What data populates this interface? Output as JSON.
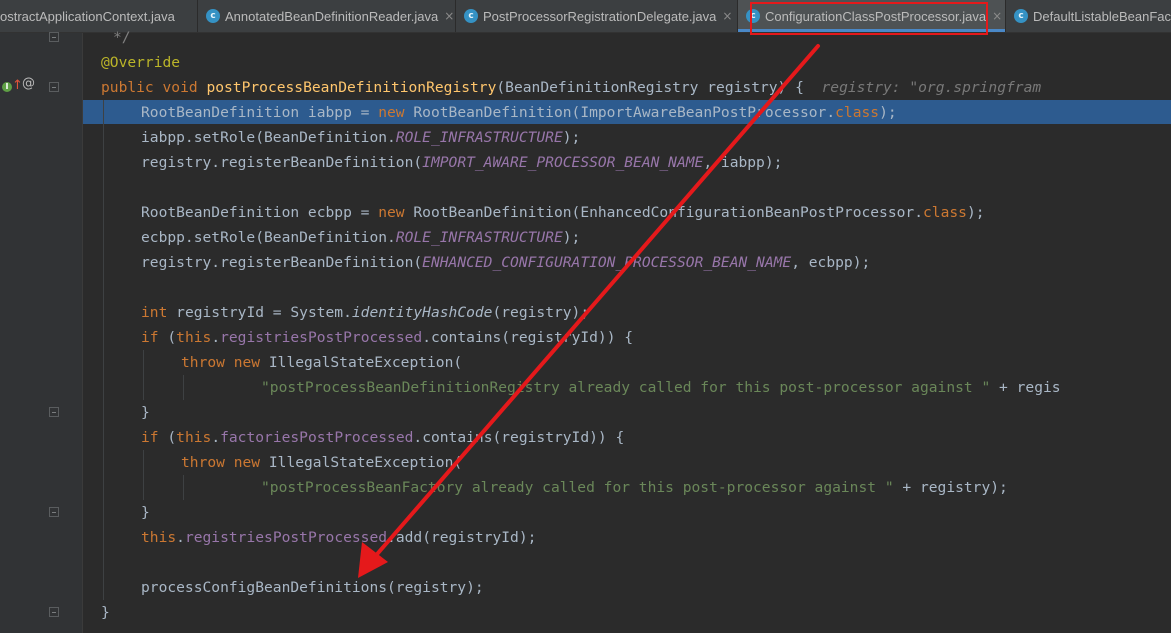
{
  "tabs": [
    {
      "label": "ostractApplicationContext.java",
      "icon": "class-icon",
      "active": false
    },
    {
      "label": "AnnotatedBeanDefinitionReader.java",
      "icon": "class-icon",
      "active": false
    },
    {
      "label": "PostProcessorRegistrationDelegate.java",
      "icon": "class-icon",
      "active": false
    },
    {
      "label": "ConfigurationClassPostProcessor.java",
      "icon": "class-icon",
      "active": true
    },
    {
      "label": "DefaultListableBeanFactc",
      "icon": "class-icon",
      "active": false
    }
  ],
  "close_glyph": "×",
  "icon_letter": "c",
  "gutter": {
    "implements_marker": "↑",
    "annotation_marker": "@"
  },
  "code": {
    "l0": "*/",
    "l1": "@Override",
    "l2": {
      "kw": "public void ",
      "fn": "postProcessBeanDefinitionRegistry",
      "rest": "(BeanDefinitionRegistry registry) {",
      "hint": "registry: \"org.springfram"
    },
    "l3": {
      "a": "RootBeanDefinition iabpp = ",
      "kw": "new ",
      "b": "RootBeanDefinition(ImportAwareBeanPostProcessor.",
      "kw2": "class",
      "c": ");"
    },
    "l4": {
      "a": "iabpp.setRole(BeanDefinition.",
      "fld": "ROLE_INFRASTRUCTURE",
      "c": ");"
    },
    "l5": {
      "a": "registry.registerBeanDefinition(",
      "fld": "IMPORT_AWARE_PROCESSOR_BEAN_NAME",
      "c": ", iabpp);"
    },
    "l7": {
      "a": "RootBeanDefinition ecbpp = ",
      "kw": "new ",
      "b": "RootBeanDefinition(EnhancedConfigurationBeanPostProcessor.",
      "kw2": "class",
      "c": ");"
    },
    "l8": {
      "a": "ecbpp.setRole(BeanDefinition.",
      "fld": "ROLE_INFRASTRUCTURE",
      "c": ");"
    },
    "l9": {
      "a": "registry.registerBeanDefinition(",
      "fld": "ENHANCED_CONFIGURATION_PROCESSOR_BEAN_NAME",
      "c": ", ecbpp);"
    },
    "l11": {
      "kw": "int ",
      "a": "registryId = System.",
      "it": "identityHashCode",
      "c": "(registry);"
    },
    "l12": {
      "kw": "if ",
      "a": "(",
      "kw2": "this",
      "b": ".",
      "fld": "registriesPostProcessed",
      "c": ".contains(registryId)) {"
    },
    "l13": {
      "kw": "throw new ",
      "a": "IllegalStateException("
    },
    "l14": {
      "str": "\"postProcessBeanDefinitionRegistry already called for this post-processor against \"",
      "a": " + regis"
    },
    "l15": "}",
    "l16": {
      "kw": "if ",
      "a": "(",
      "kw2": "this",
      "b": ".",
      "fld": "factoriesPostProcessed",
      "c": ".contains(registryId)) {"
    },
    "l17": {
      "kw": "throw new ",
      "a": "IllegalStateException("
    },
    "l18": {
      "str": "\"postProcessBeanFactory already called for this post-processor against \"",
      "a": " + registry);"
    },
    "l19": "}",
    "l20": {
      "kw": "this",
      "b": ".",
      "fld": "registriesPostProcessed",
      "c": ".add(registryId);"
    },
    "l22": "processConfigBeanDefinitions(registry);",
    "l23": "}"
  },
  "colors": {
    "annotation_box": "#e5191b",
    "arrow": "#e5191b",
    "selection": "#2d5b8f"
  }
}
